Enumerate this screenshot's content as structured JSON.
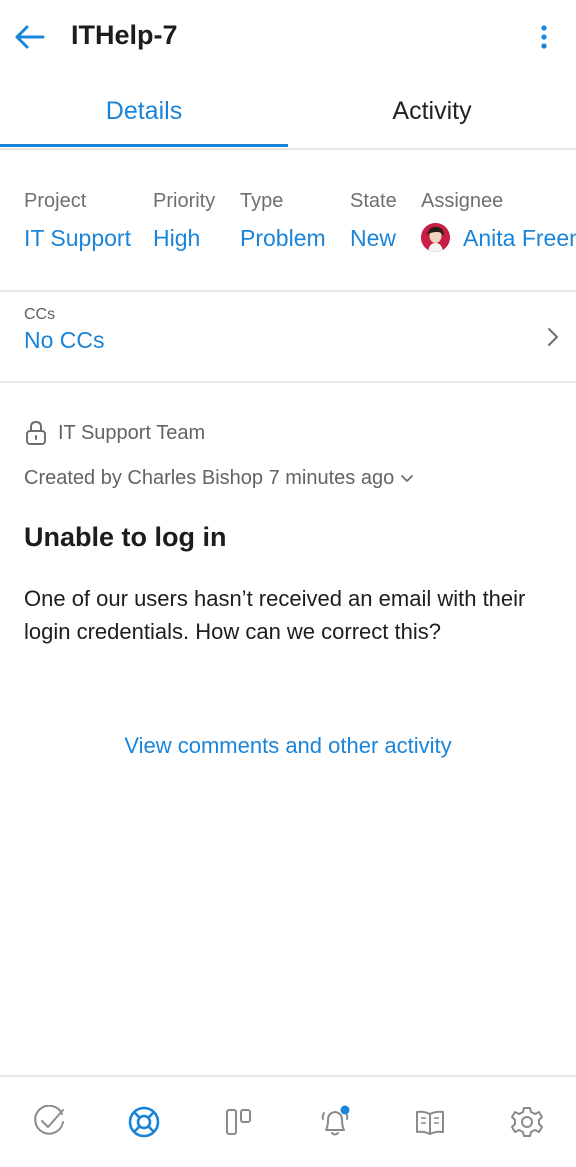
{
  "header": {
    "title": "ITHelp-7",
    "back_icon": "back-arrow-icon",
    "menu_icon": "more-vertical-icon"
  },
  "tabs": [
    {
      "label": "Details",
      "selected": true
    },
    {
      "label": "Activity",
      "selected": false
    }
  ],
  "fields": {
    "project": {
      "label": "Project",
      "value": "IT Support"
    },
    "priority": {
      "label": "Priority",
      "value": "High"
    },
    "type": {
      "label": "Type",
      "value": "Problem"
    },
    "state": {
      "label": "State",
      "value": "New"
    },
    "assignee": {
      "label": "Assignee",
      "value": "Anita Freen"
    }
  },
  "ccs": {
    "label": "CCs",
    "value": "No CCs"
  },
  "team": "IT Support Team",
  "created": "Created by Charles Bishop 7 minutes ago",
  "issue": {
    "title": "Unable to log in",
    "description": "One of our users hasn’t received an email with their login credentials. How can we correct this?"
  },
  "view_activity_link": "View comments and other activity",
  "bottom_nav": {
    "items": [
      {
        "icon": "check-circle-icon",
        "active": false
      },
      {
        "icon": "lifebuoy-icon",
        "active": true
      },
      {
        "icon": "board-icon",
        "active": false
      },
      {
        "icon": "notification-bell-icon",
        "active": false
      },
      {
        "icon": "knowledge-base-book-icon",
        "active": false
      },
      {
        "icon": "settings-gear-icon",
        "active": false
      }
    ]
  },
  "colors": {
    "accent": "#1a84d9",
    "muted": "#6f6f6f",
    "text": "#1d1d1f"
  }
}
